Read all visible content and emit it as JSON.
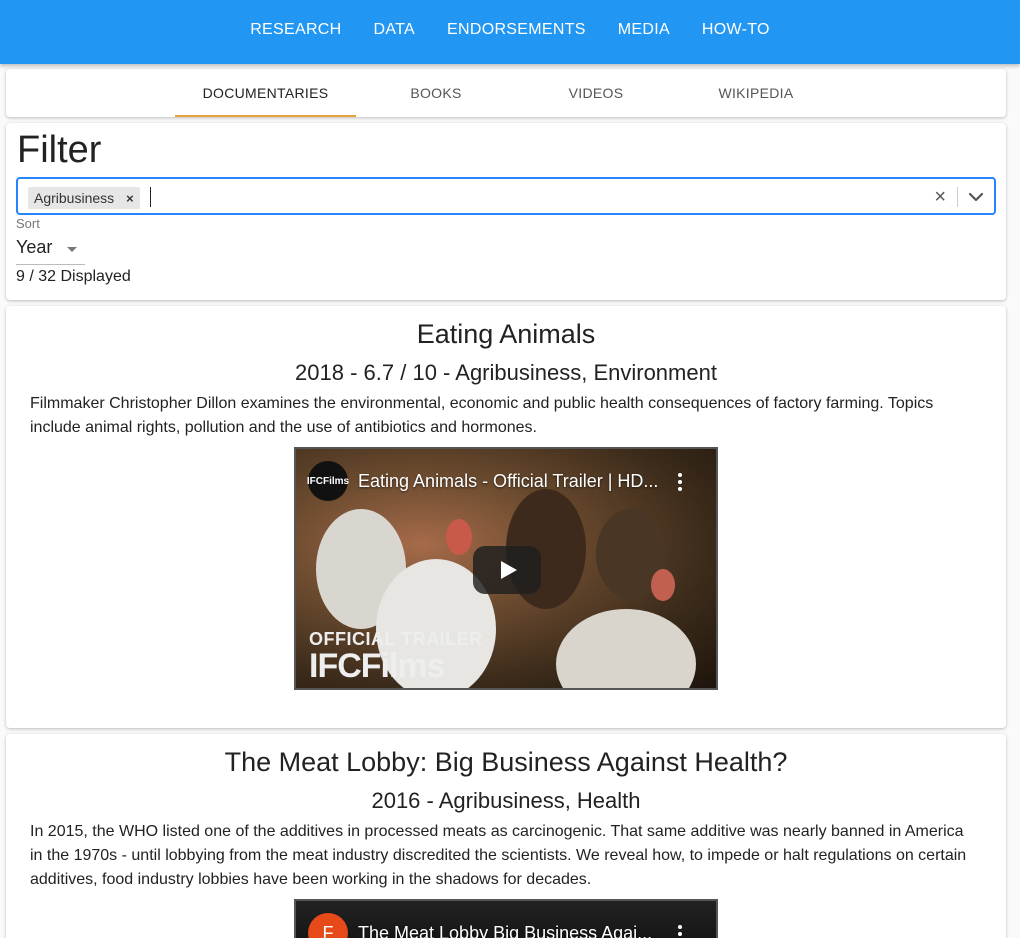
{
  "topnav": {
    "items": [
      "RESEARCH",
      "DATA",
      "ENDORSEMENTS",
      "MEDIA",
      "HOW-TO"
    ]
  },
  "tabs": {
    "items": [
      "DOCUMENTARIES",
      "BOOKS",
      "VIDEOS",
      "WIKIPEDIA"
    ],
    "active": "DOCUMENTARIES"
  },
  "filter": {
    "title": "Filter",
    "tag": "Agribusiness",
    "tag_remove": "×",
    "clear": "×",
    "sort_label": "Sort",
    "sort_value": "Year",
    "displayed": "9 / 32 Displayed"
  },
  "documentaries": [
    {
      "title": "Eating Animals",
      "meta": "2018 - 6.7 / 10 - Agribusiness, Environment",
      "description": "Filmmaker Christopher Dillon examines the environmental, economic and public health consequences of factory farming. Topics include animal rights, pollution and the use of antibiotics and hormones.",
      "video": {
        "channel": "IFC Films",
        "channel_logo_text": "IFCFilms",
        "title": "Eating Animals - Official Trailer | HD...",
        "overlay_line1": "OFFICIAL TRAILER",
        "overlay_line2": "IFCFilms"
      }
    },
    {
      "title": "The Meat Lobby: Big Business Against Health?",
      "meta": "2016 - Agribusiness, Health",
      "description": "In 2015, the WHO listed one of the additives in processed meats as carcinogenic. That same additive was nearly banned in America in the 1970s - until lobbying from the meat industry discredited the scientists. We reveal how, to impede or halt regulations on certain additives, food industry lobbies have been working in the shadows for decades.",
      "video": {
        "channel_logo_text": "F",
        "title": "The Meat Lobby Big Business Agai..."
      }
    }
  ],
  "colors": {
    "appbar": "#2196f3",
    "tab_indicator": "#e6a23c",
    "select_border": "#2684ff",
    "channel2": "#e64a19"
  },
  "icons": {
    "tag_remove": "close-icon",
    "clear": "close-icon",
    "dropdown": "chevron-down-icon",
    "video_menu": "more-vert-icon",
    "play": "play-icon"
  }
}
